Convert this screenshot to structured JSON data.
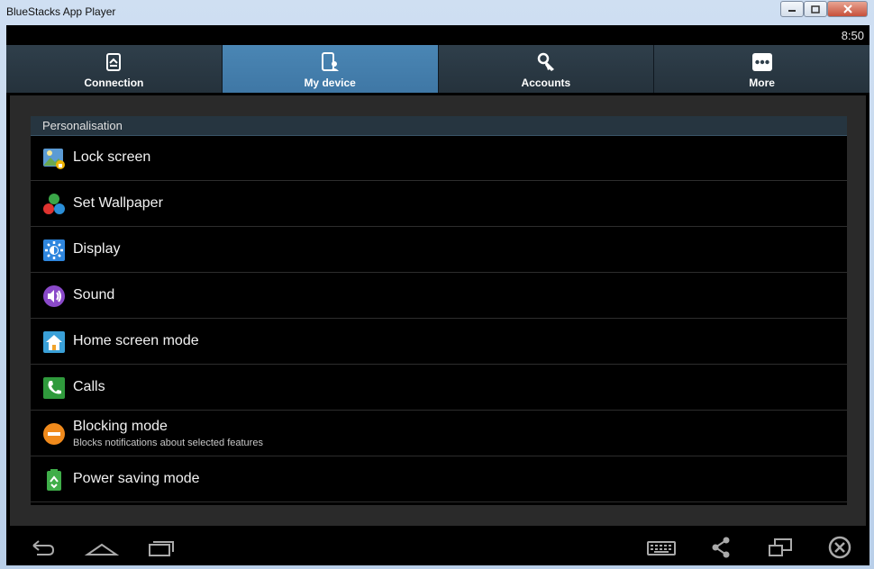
{
  "window": {
    "title": "BlueStacks App Player"
  },
  "status": {
    "time": "8:50"
  },
  "tabs": [
    {
      "label": "Connection",
      "icon": "connection-icon",
      "active": false
    },
    {
      "label": "My device",
      "icon": "my-device-icon",
      "active": true
    },
    {
      "label": "Accounts",
      "icon": "accounts-icon",
      "active": false
    },
    {
      "label": "More",
      "icon": "more-icon",
      "active": false
    }
  ],
  "section": {
    "title": "Personalisation"
  },
  "items": [
    {
      "label": "Lock screen",
      "icon": "lock-screen-icon"
    },
    {
      "label": "Set Wallpaper",
      "icon": "wallpaper-icon"
    },
    {
      "label": "Display",
      "icon": "display-icon"
    },
    {
      "label": "Sound",
      "icon": "sound-icon"
    },
    {
      "label": "Home screen mode",
      "icon": "home-screen-mode-icon"
    },
    {
      "label": "Calls",
      "icon": "calls-icon"
    },
    {
      "label": "Blocking mode",
      "sub": "Blocks notifications about selected features",
      "icon": "blocking-mode-icon"
    },
    {
      "label": "Power saving mode",
      "icon": "power-saving-icon"
    }
  ],
  "colors": {
    "active_tab": "#4a86b4",
    "tab_bg": "#2f3f4b",
    "section_bg": "#263540"
  }
}
